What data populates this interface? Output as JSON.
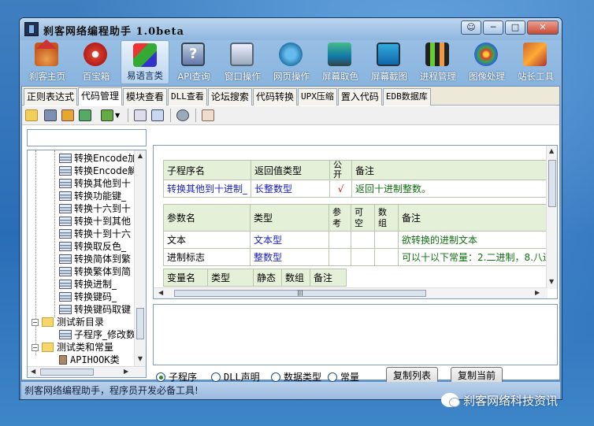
{
  "window": {
    "title": "刹客网络编程助手 1.0beta",
    "buttons": [
      "☺",
      "─",
      "□",
      "✕"
    ]
  },
  "toolbar": [
    {
      "label": "刹客主页",
      "icon": "home-icon"
    },
    {
      "label": "百宝箱",
      "icon": "toolbox-icon"
    },
    {
      "label": "易语言类",
      "icon": "cubes-icon",
      "active": true
    },
    {
      "label": "API查询",
      "icon": "api-help-icon"
    },
    {
      "label": "窗口操作",
      "icon": "window-icon"
    },
    {
      "label": "网页操作",
      "icon": "globe-icon"
    },
    {
      "label": "屏幕取色",
      "icon": "color-picker-icon"
    },
    {
      "label": "屏幕截图",
      "icon": "screenshot-icon"
    },
    {
      "label": "进程管理",
      "icon": "process-icon"
    },
    {
      "label": "图像处理",
      "icon": "image-icon"
    },
    {
      "label": "站长工具",
      "icon": "tools-icon"
    }
  ],
  "tabs": [
    "正则表达式",
    "代码管理",
    "模块查看",
    "DLL查看",
    "论坛搜索",
    "代码转换",
    "UPX压缩",
    "置入代码",
    "EDB数据库"
  ],
  "active_tab": "代码管理",
  "tree": {
    "items": [
      "转换Encode加",
      "转换Encode解",
      "转换其他到十",
      "转换功能键_",
      "转换十六到十",
      "转换十到其他",
      "转换十到十六",
      "转换取反色_",
      "转换简体到繁",
      "转换繁体到简",
      "转换进制_",
      "转换键码_",
      "转换键码取键"
    ],
    "folder1": "测试新目录",
    "folder1_child": "子程序_修改数",
    "folder2": "测试类和常量",
    "folder2_child": "APIHOOK类"
  },
  "grid": {
    "sub_headers": [
      "子程序名",
      "返回值类型",
      "公开",
      "备注"
    ],
    "sub_row": {
      "name": "转换其他到十进制_",
      "return_type": "长整数型",
      "public": "√",
      "note": "返回十进制整数。"
    },
    "param_headers": [
      "参数名",
      "类型",
      "参考",
      "可空",
      "数组",
      "备注"
    ],
    "params": [
      {
        "name": "文本",
        "type": "文本型",
        "note": "欲转换的进制文本"
      },
      {
        "name": "进制标志",
        "type": "整数型",
        "note": "可以十以下常量：2.二进制，8.八进"
      }
    ],
    "var_headers": [
      "变量名",
      "类型",
      "静态",
      "数组",
      "备注"
    ]
  },
  "radios": [
    {
      "label": "子程序",
      "checked": true
    },
    {
      "label": "DLL声明",
      "checked": false
    },
    {
      "label": "数据类型",
      "checked": false
    },
    {
      "label": "常量",
      "checked": false
    }
  ],
  "buttons": {
    "copy_list": "复制列表",
    "copy_current": "复制当前"
  },
  "status": "刹客网络编程助手，程序员开发必备工具!",
  "watermark": "刹客网络科技资讯"
}
